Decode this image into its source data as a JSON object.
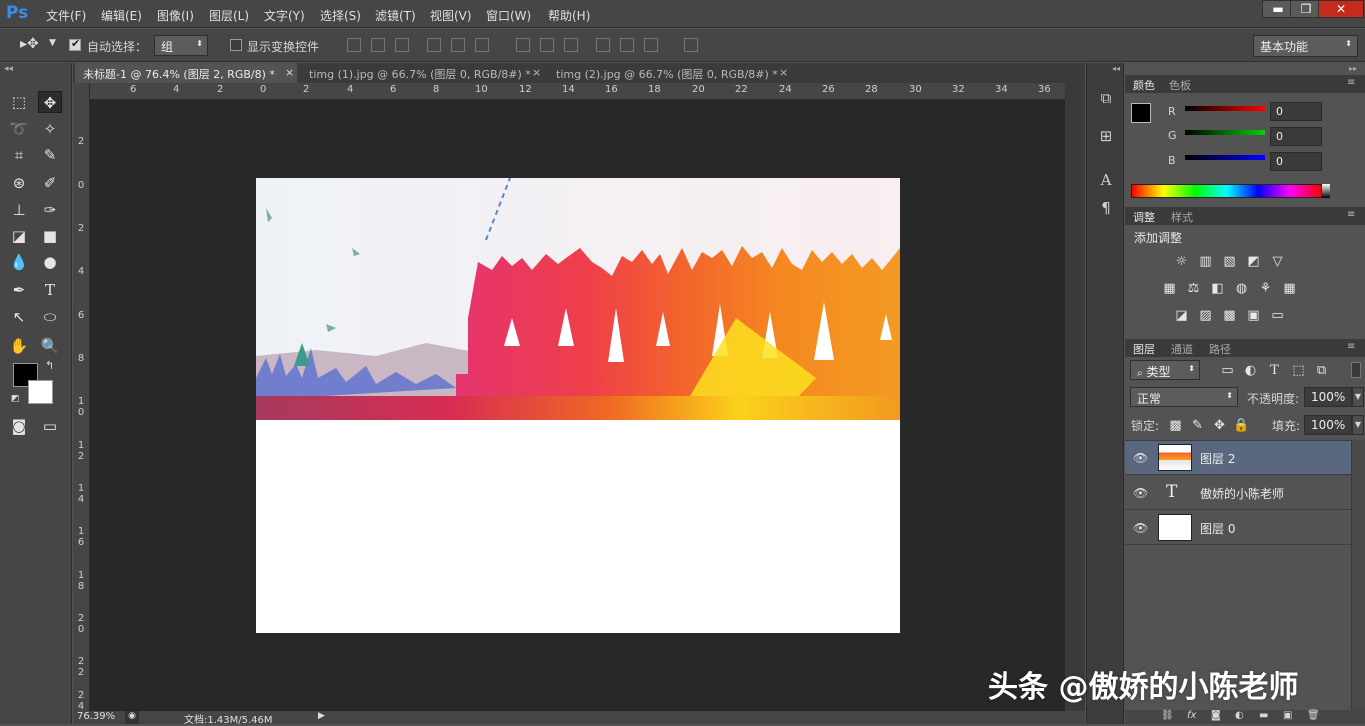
{
  "app": {
    "logo": "Ps"
  },
  "menu": [
    "文件(F)",
    "编辑(E)",
    "图像(I)",
    "图层(L)",
    "文字(Y)",
    "选择(S)",
    "滤镜(T)",
    "视图(V)",
    "窗口(W)",
    "帮助(H)"
  ],
  "window_controls": {
    "minimize": "▬",
    "restore": "❐",
    "close": "✕"
  },
  "options": {
    "auto_select_label": "自动选择：",
    "auto_select_checked": true,
    "auto_select_value": "组",
    "show_transform_label": "显示变换控件",
    "workspace_value": "基本功能"
  },
  "tabs": [
    {
      "label": "未标题-1 @ 76.4% (图层 2, RGB/8) *",
      "close": "×"
    },
    {
      "label": "timg (1).jpg @ 66.7% (图层 0, RGB/8#) *",
      "close": "×"
    },
    {
      "label": "timg (2).jpg @ 66.7% (图层 0, RGB/8#) *",
      "close": "×"
    }
  ],
  "ruler_h": [
    "6",
    "4",
    "2",
    "0",
    "2",
    "4",
    "6",
    "8",
    "10",
    "12",
    "14",
    "16",
    "18",
    "20",
    "22",
    "24",
    "26",
    "28",
    "30",
    "32",
    "34",
    "36"
  ],
  "ruler_v": [
    "2",
    "0",
    "2",
    "4",
    "6",
    "8",
    "10",
    "12",
    "14",
    "16",
    "18",
    "20",
    "22",
    "24"
  ],
  "status": {
    "zoom": "76.39%",
    "doc": "文档:1.43M/5.46M"
  },
  "color_panel": {
    "tabs": [
      "颜色",
      "色板"
    ],
    "channels": [
      {
        "label": "R",
        "value": "0",
        "color": "#ff0000"
      },
      {
        "label": "G",
        "value": "0",
        "color": "#00d400"
      },
      {
        "label": "B",
        "value": "0",
        "color": "#0000ff"
      }
    ],
    "foreground": "#000000",
    "background": "#ffffff"
  },
  "adjust_panel": {
    "tabs": [
      "调整",
      "样式"
    ],
    "title": "添加调整"
  },
  "layers_panel": {
    "tabs": [
      "图层",
      "通道",
      "路径"
    ],
    "filter_kind": "类型",
    "blend_mode": "正常",
    "opacity_label": "不透明度:",
    "opacity": "100%",
    "lock_label": "锁定:",
    "fill_label": "填充:",
    "fill": "100%",
    "layers": [
      {
        "name": "图层 2",
        "type": "image",
        "selected": true
      },
      {
        "name": "傲娇的小陈老师",
        "type": "text",
        "selected": false
      },
      {
        "name": "图层 0",
        "type": "fill-white",
        "selected": false
      }
    ]
  },
  "watermark": "头条 @傲娇的小陈老师",
  "colors": {
    "accent_blue": "#3a8ee6",
    "workspace_bg": "#282828",
    "panel_bg": "#535353",
    "selected_layer": "#59687e"
  }
}
